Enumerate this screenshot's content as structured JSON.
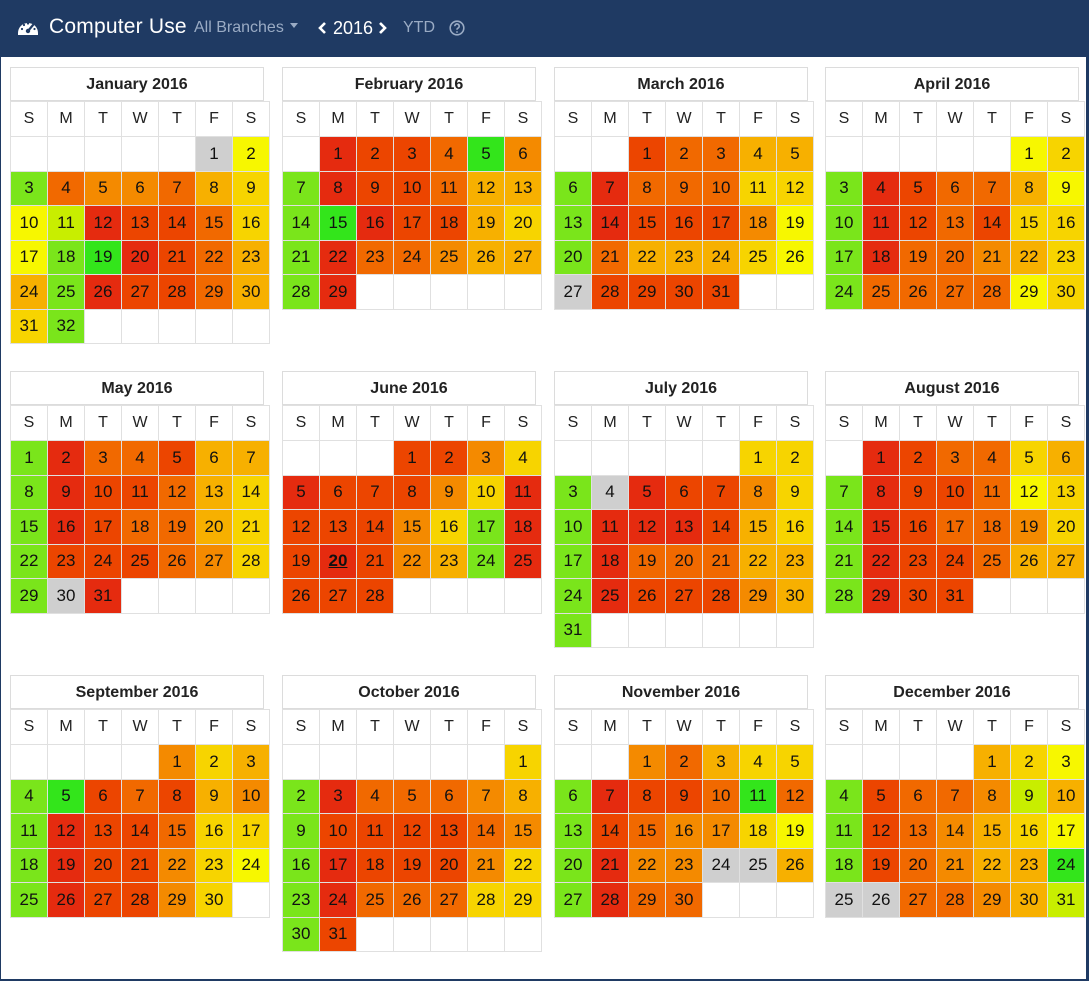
{
  "app": {
    "title": "Computer Use",
    "branch_label": "All Branches",
    "year": "2016",
    "ytd_label": "YTD"
  },
  "icons": {
    "logo": "dashboard-gauge-icon",
    "prev": "chevron-left-icon",
    "next": "chevron-right-icon",
    "help": "question-circle-icon"
  },
  "weekday_headers": [
    "S",
    "M",
    "T",
    "W",
    "T",
    "F",
    "S"
  ],
  "usage_scale": {
    "0": "#cfcfcf",
    "1": "#33e51b",
    "2": "#7ae51b",
    "3": "#c8ee00",
    "4": "#f7f700",
    "5": "#f7d400",
    "6": "#f7b000",
    "7": "#f48a00",
    "8": "#f16900",
    "9": "#ec4500",
    "10": "#e52b0f"
  },
  "months": [
    {
      "name": "January 2016",
      "start": 5,
      "levels": [
        0,
        4,
        2,
        8,
        7,
        7,
        8,
        6,
        5,
        4,
        3,
        10,
        9,
        9,
        8,
        5,
        4,
        2,
        1,
        10,
        9,
        8,
        6,
        6,
        2,
        10,
        9,
        9,
        8,
        6,
        5,
        2
      ]
    },
    {
      "name": "February 2016",
      "start": 1,
      "levels": [
        10,
        9,
        9,
        8,
        1,
        7,
        2,
        10,
        9,
        9,
        8,
        6,
        6,
        2,
        1,
        10,
        9,
        9,
        6,
        5,
        2,
        10,
        8,
        8,
        7,
        6,
        6,
        2,
        10
      ]
    },
    {
      "name": "March 2016",
      "start": 2,
      "levels": [
        9,
        8,
        8,
        6,
        6,
        2,
        10,
        8,
        8,
        8,
        5,
        5,
        2,
        10,
        9,
        9,
        9,
        7,
        4,
        2,
        8,
        6,
        6,
        6,
        5,
        4,
        0,
        9,
        9,
        9,
        9
      ]
    },
    {
      "name": "April 2016",
      "start": 5,
      "levels": [
        4,
        5,
        2,
        10,
        9,
        8,
        8,
        6,
        4,
        2,
        10,
        9,
        8,
        9,
        5,
        5,
        2,
        10,
        8,
        8,
        7,
        6,
        5,
        2,
        8,
        8,
        8,
        8,
        4,
        5
      ]
    },
    {
      "name": "May 2016",
      "start": 0,
      "levels": [
        2,
        10,
        8,
        8,
        9,
        6,
        6,
        2,
        10,
        9,
        9,
        8,
        6,
        5,
        2,
        10,
        9,
        8,
        8,
        6,
        5,
        2,
        9,
        9,
        9,
        8,
        7,
        5,
        2,
        0,
        10
      ]
    },
    {
      "name": "June 2016",
      "start": 3,
      "levels": [
        9,
        9,
        7,
        5,
        10,
        9,
        9,
        9,
        7,
        5,
        10,
        9,
        9,
        9,
        7,
        5,
        2,
        10,
        9,
        10,
        9,
        7,
        6,
        2,
        10,
        9,
        9,
        9
      ]
    },
    {
      "name": "July 2016",
      "start": 5,
      "levels": [
        5,
        5,
        2,
        0,
        10,
        9,
        9,
        7,
        5,
        2,
        10,
        10,
        10,
        9,
        6,
        5,
        2,
        10,
        8,
        8,
        8,
        6,
        6,
        2,
        10,
        9,
        9,
        9,
        7,
        6,
        2
      ]
    },
    {
      "name": "August 2016",
      "start": 1,
      "levels": [
        10,
        9,
        8,
        8,
        5,
        6,
        2,
        10,
        9,
        9,
        8,
        4,
        5,
        2,
        10,
        9,
        8,
        8,
        7,
        5,
        2,
        10,
        9,
        9,
        8,
        6,
        6,
        2,
        10,
        9,
        9
      ]
    },
    {
      "name": "September 2016",
      "start": 4,
      "levels": [
        7,
        5,
        6,
        2,
        1,
        9,
        8,
        9,
        6,
        7,
        2,
        10,
        9,
        9,
        8,
        5,
        5,
        2,
        10,
        9,
        9,
        7,
        5,
        4,
        2,
        10,
        9,
        9,
        7,
        5
      ]
    },
    {
      "name": "October 2016",
      "start": 6,
      "levels": [
        5,
        2,
        10,
        8,
        8,
        8,
        7,
        6,
        2,
        9,
        9,
        9,
        9,
        8,
        7,
        2,
        10,
        9,
        9,
        9,
        7,
        5,
        2,
        10,
        8,
        8,
        8,
        5,
        5,
        2,
        9
      ]
    },
    {
      "name": "November 2016",
      "start": 2,
      "levels": [
        7,
        8,
        6,
        5,
        5,
        2,
        10,
        9,
        9,
        8,
        1,
        8,
        2,
        9,
        8,
        7,
        7,
        5,
        4,
        2,
        10,
        7,
        7,
        0,
        0,
        6,
        2,
        10,
        8,
        8
      ]
    },
    {
      "name": "December 2016",
      "start": 4,
      "levels": [
        6,
        5,
        4,
        2,
        9,
        8,
        8,
        7,
        3,
        6,
        2,
        9,
        8,
        7,
        6,
        5,
        4,
        2,
        9,
        8,
        7,
        6,
        6,
        1,
        0,
        0,
        8,
        8,
        7,
        6,
        3
      ]
    }
  ],
  "highlighted_days": [
    {
      "month": "June 2016",
      "day": 20
    }
  ]
}
